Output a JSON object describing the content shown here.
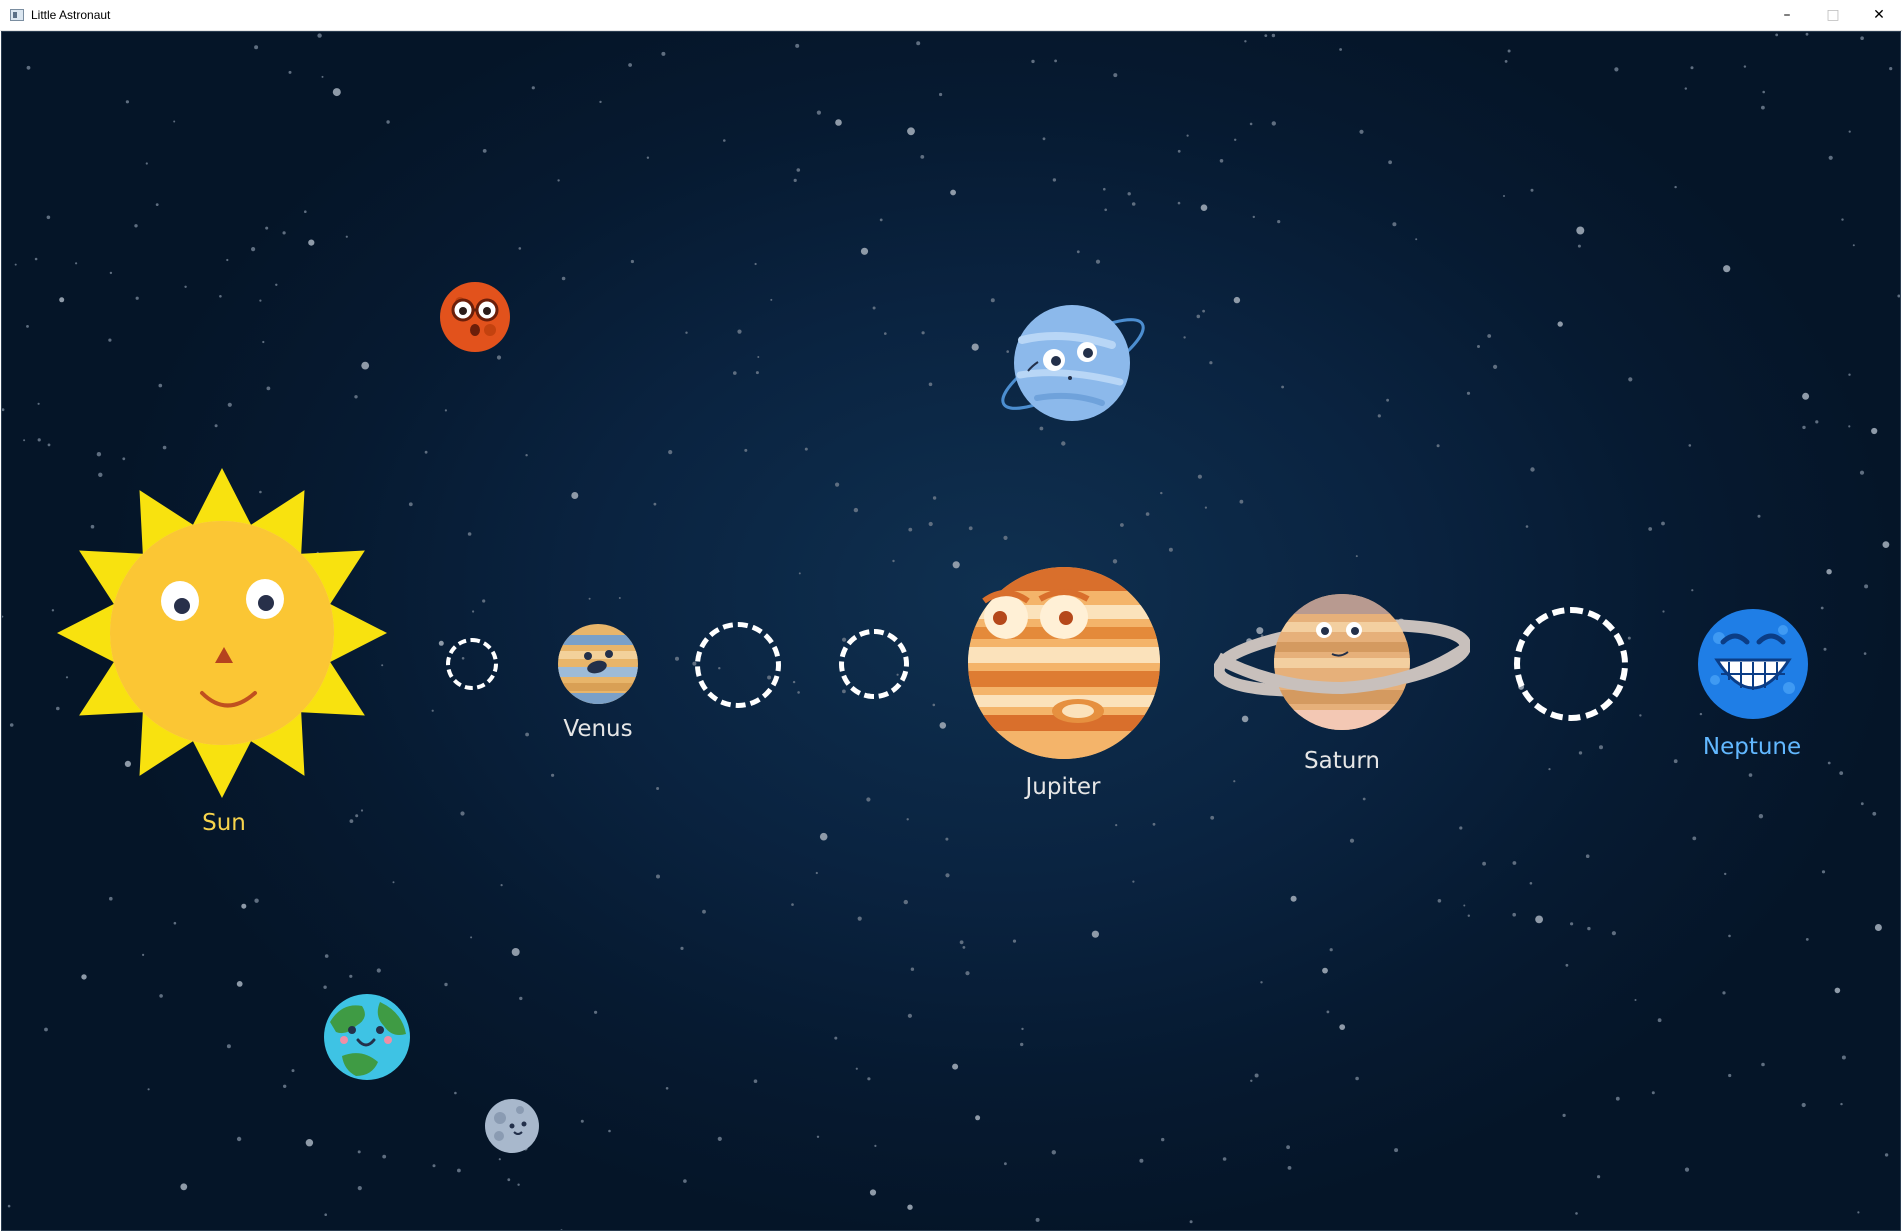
{
  "window": {
    "title": "Little Astronaut",
    "minimize_icon": "minimize-icon",
    "maximize_icon": "maximize-icon",
    "close_icon": "close-icon"
  },
  "labels": {
    "sun": "Sun",
    "venus": "Venus",
    "jupiter": "Jupiter",
    "saturn": "Saturn",
    "neptune": "Neptune"
  },
  "colors": {
    "sun_label": "#f7d34c",
    "planet_label": "#e6e6e6",
    "neptune_label": "#62b8ff",
    "background": "#0a2340"
  }
}
